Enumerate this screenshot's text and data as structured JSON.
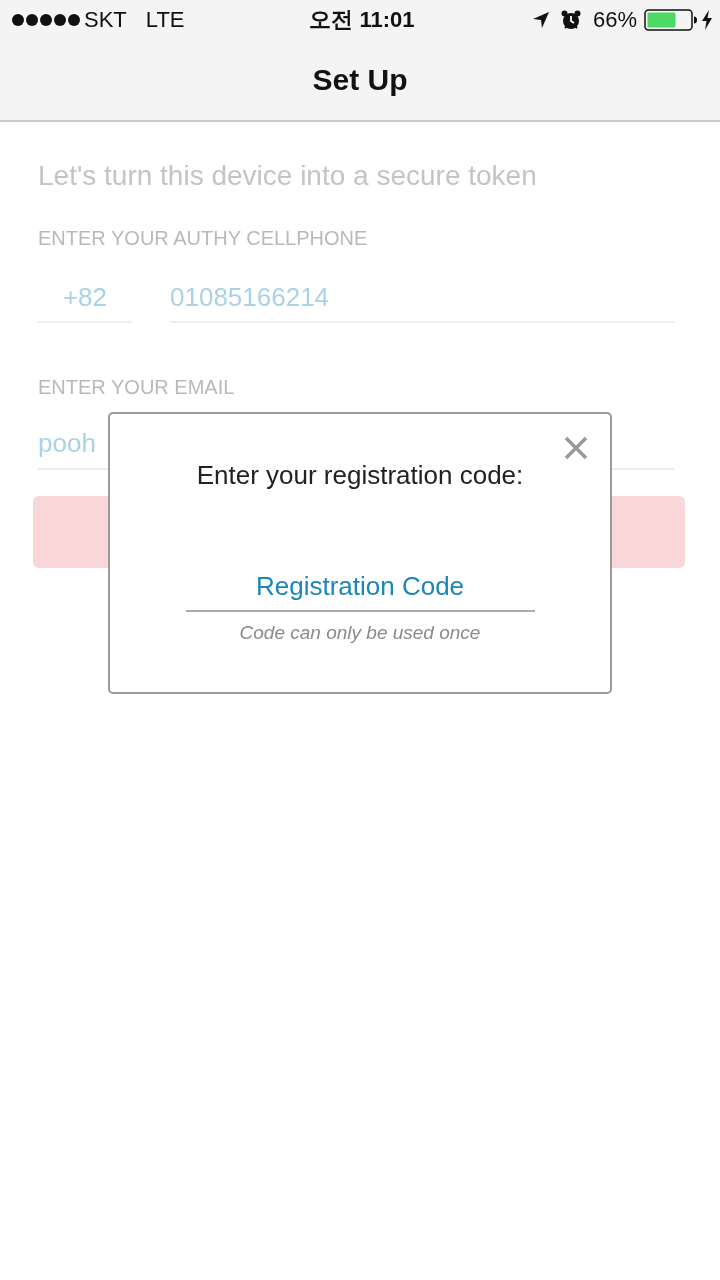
{
  "status_bar": {
    "carrier": "SKT",
    "network": "LTE",
    "time": "오전 11:01",
    "battery": "66%",
    "charging": true
  },
  "nav_bar": {
    "title": "Set Up"
  },
  "form": {
    "heading": "Let's turn this device into a secure token",
    "phone_label": "ENTER YOUR AUTHY CELLPHONE",
    "country_code": "+82",
    "phone": "01085166214",
    "email_label": "ENTER YOUR EMAIL",
    "email": "pooh"
  },
  "dialog": {
    "title": "Enter your registration code:",
    "placeholder": "Registration Code",
    "hint": "Code can only be used once"
  }
}
